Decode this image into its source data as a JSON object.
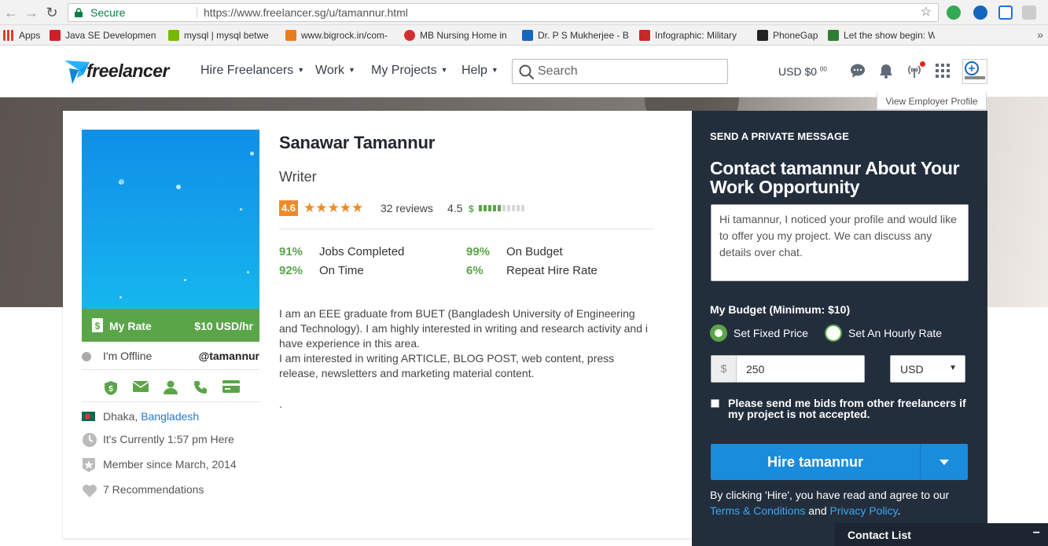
{
  "browser": {
    "secure_label": "Secure",
    "url": "https://www.freelancer.sg/u/tamannur.html",
    "bookmarks": [
      {
        "label": "Apps",
        "color": "#e23b2e"
      },
      {
        "label": "Java SE Development",
        "color": "#d11f2a"
      },
      {
        "label": "mysql | mysql betwe",
        "color": "#76b900"
      },
      {
        "label": "www.bigrock.in/com-",
        "color": "#e67e22"
      },
      {
        "label": "MB Nursing Home in",
        "color": "#d32f2f"
      },
      {
        "label": "Dr. P S Mukherjee - B",
        "color": "#1565c0"
      },
      {
        "label": "Infographic: Military",
        "color": "#c62828"
      },
      {
        "label": "PhoneGap",
        "color": "#222222"
      },
      {
        "label": "Let the show begin: W",
        "color": "#2e7d32"
      }
    ],
    "more": "»"
  },
  "header": {
    "logo_text": "freelancer",
    "nav": [
      {
        "label": "Hire Freelancers"
      },
      {
        "label": "Work"
      },
      {
        "label": "My Projects"
      },
      {
        "label": "Help"
      }
    ],
    "search_placeholder": "Search",
    "balance": "USD $0",
    "balance_cents": "00",
    "view_employer": "View Employer Profile"
  },
  "profile": {
    "name": "Sanawar Tamannur",
    "title": "Writer",
    "rating": "4.6",
    "stars": "★★★★★",
    "reviews": "32 reviews",
    "earnings_score": "4.5",
    "earnings_fill": 0.5,
    "my_rate_label": "My Rate",
    "my_rate_value": "$10 USD/hr",
    "status": "I'm Offline",
    "handle": "@tamannur",
    "location_city": "Dhaka, ",
    "location_country": "Bangladesh",
    "local_time": "It's Currently 1:57 pm Here",
    "member_since": "Member since March, 2014",
    "recommendations": "7 Recommendations",
    "stats": [
      {
        "pct": "91%",
        "label": "Jobs Completed"
      },
      {
        "pct": "92%",
        "label": "On Time"
      },
      {
        "pct": "99%",
        "label": "On Budget"
      },
      {
        "pct": "6%",
        "label": "Repeat Hire Rate"
      }
    ],
    "bio": "I am an EEE graduate from BUET (Bangladesh University of Engineering and Technology). I am highly interested in writing and research activity and i have experience in this area.\nI am interested in writing ARTICLE, BLOG POST, web content, press release, newsletters and marketing material content.",
    "bio_trailing": "."
  },
  "contact": {
    "heading": "SEND A PRIVATE MESSAGE",
    "title": "Contact tamannur About Your Work Opportunity",
    "message": "Hi tamannur, I noticed your profile and would like to offer you my project. We can discuss any details over chat.",
    "budget_label": "My Budget (Minimum: $10)",
    "option_fixed": "Set Fixed Price",
    "option_hourly": "Set An Hourly Rate",
    "selected_option": "fixed",
    "currency_symbol": "$",
    "amount": "250",
    "currency": "USD",
    "checkbox_label": "Please send me bids from other freelancers if my project is not accepted.",
    "hire_label": "Hire tamannur",
    "terms_prefix": "By clicking 'Hire', you have read and agree to our ",
    "terms_link": "Terms & Conditions",
    "terms_and": " and ",
    "privacy_link": "Privacy Policy",
    "terms_suffix": "."
  },
  "contact_list": {
    "label": "Contact List",
    "minimize": "−"
  },
  "colors": {
    "accent_green": "#5ba549",
    "primary_blue": "#1a8cdc",
    "panel_dark": "#232e3d",
    "rating_orange": "#f08a24"
  }
}
